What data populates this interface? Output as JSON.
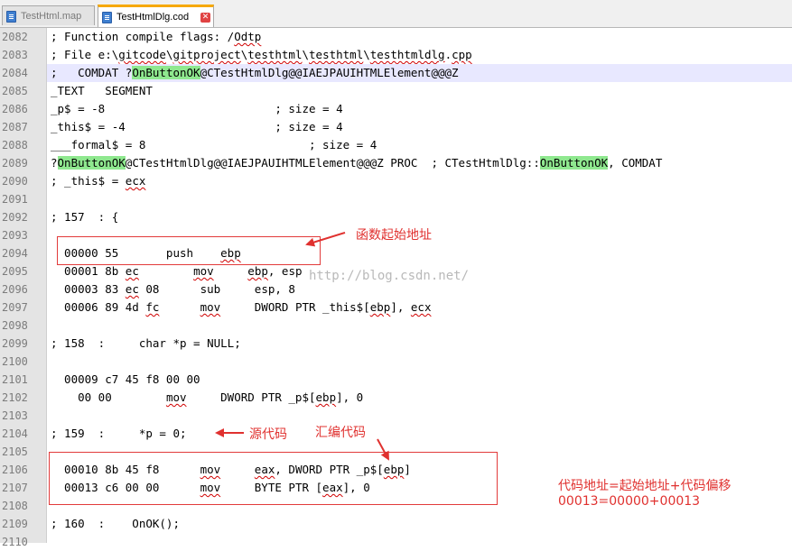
{
  "tabs": [
    {
      "label": "TestHtml.map",
      "active": false
    },
    {
      "label": "TestHtmlDlg.cod",
      "active": true
    }
  ],
  "lines": [
    {
      "num": "2082",
      "code": "; Function compile flags: /Odtp"
    },
    {
      "num": "2083",
      "code": "; File e:\\gitcode\\gitproject\\testhtml\\testhtml\\testhtmldlg.cpp"
    },
    {
      "num": "2084",
      "code": ";   COMDAT ?OnButtonOK@CTestHtmlDlg@@IAEJPAUIHTMLElement@@@Z"
    },
    {
      "num": "2085",
      "code": "_TEXT   SEGMENT"
    },
    {
      "num": "2086",
      "code": "_p$ = -8                         ; size = 4"
    },
    {
      "num": "2087",
      "code": "_this$ = -4                      ; size = 4"
    },
    {
      "num": "2088",
      "code": "___formal$ = 8                        ; size = 4"
    },
    {
      "num": "2089",
      "code": "?OnButtonOK@CTestHtmlDlg@@IAEJPAUIHTMLElement@@@Z PROC  ; CTestHtmlDlg::OnButtonOK, COMDAT"
    },
    {
      "num": "2090",
      "code": "; _this$ = ecx"
    },
    {
      "num": "2091",
      "code": ""
    },
    {
      "num": "2092",
      "code": "; 157  : {"
    },
    {
      "num": "2093",
      "code": ""
    },
    {
      "num": "2094",
      "code": "  00000 55       push    ebp"
    },
    {
      "num": "2095",
      "code": "  00001 8b ec        mov     ebp, esp"
    },
    {
      "num": "2096",
      "code": "  00003 83 ec 08      sub     esp, 8"
    },
    {
      "num": "2097",
      "code": "  00006 89 4d fc      mov     DWORD PTR _this$[ebp], ecx"
    },
    {
      "num": "2098",
      "code": ""
    },
    {
      "num": "2099",
      "code": "; 158  :     char *p = NULL;"
    },
    {
      "num": "2100",
      "code": ""
    },
    {
      "num": "2101",
      "code": "  00009 c7 45 f8 00 00"
    },
    {
      "num": "2102",
      "code": "    00 00        mov     DWORD PTR _p$[ebp], 0"
    },
    {
      "num": "2103",
      "code": ""
    },
    {
      "num": "2104",
      "code": "; 159  :     *p = 0;"
    },
    {
      "num": "2105",
      "code": ""
    },
    {
      "num": "2106",
      "code": "  00010 8b 45 f8      mov     eax, DWORD PTR _p$[ebp]"
    },
    {
      "num": "2107",
      "code": "  00013 c6 00 00      mov     BYTE PTR [eax], 0"
    },
    {
      "num": "2108",
      "code": ""
    },
    {
      "num": "2109",
      "code": "; 160  :    OnOK();"
    },
    {
      "num": "2110",
      "code": ""
    }
  ],
  "annotations": {
    "func_start": "函数起始地址",
    "source_code": "源代码",
    "asm_code": "汇编代码",
    "formula_line1": "代码地址=起始地址+代码偏移",
    "formula_line2": "00013=00000+00013"
  },
  "watermark": "http://blog.csdn.net/",
  "colors": {
    "highlight": "#8fe88f",
    "annotation": "#e0312f",
    "active_tab_accent": "#f6a800",
    "current_line": "#e8e8ff"
  }
}
